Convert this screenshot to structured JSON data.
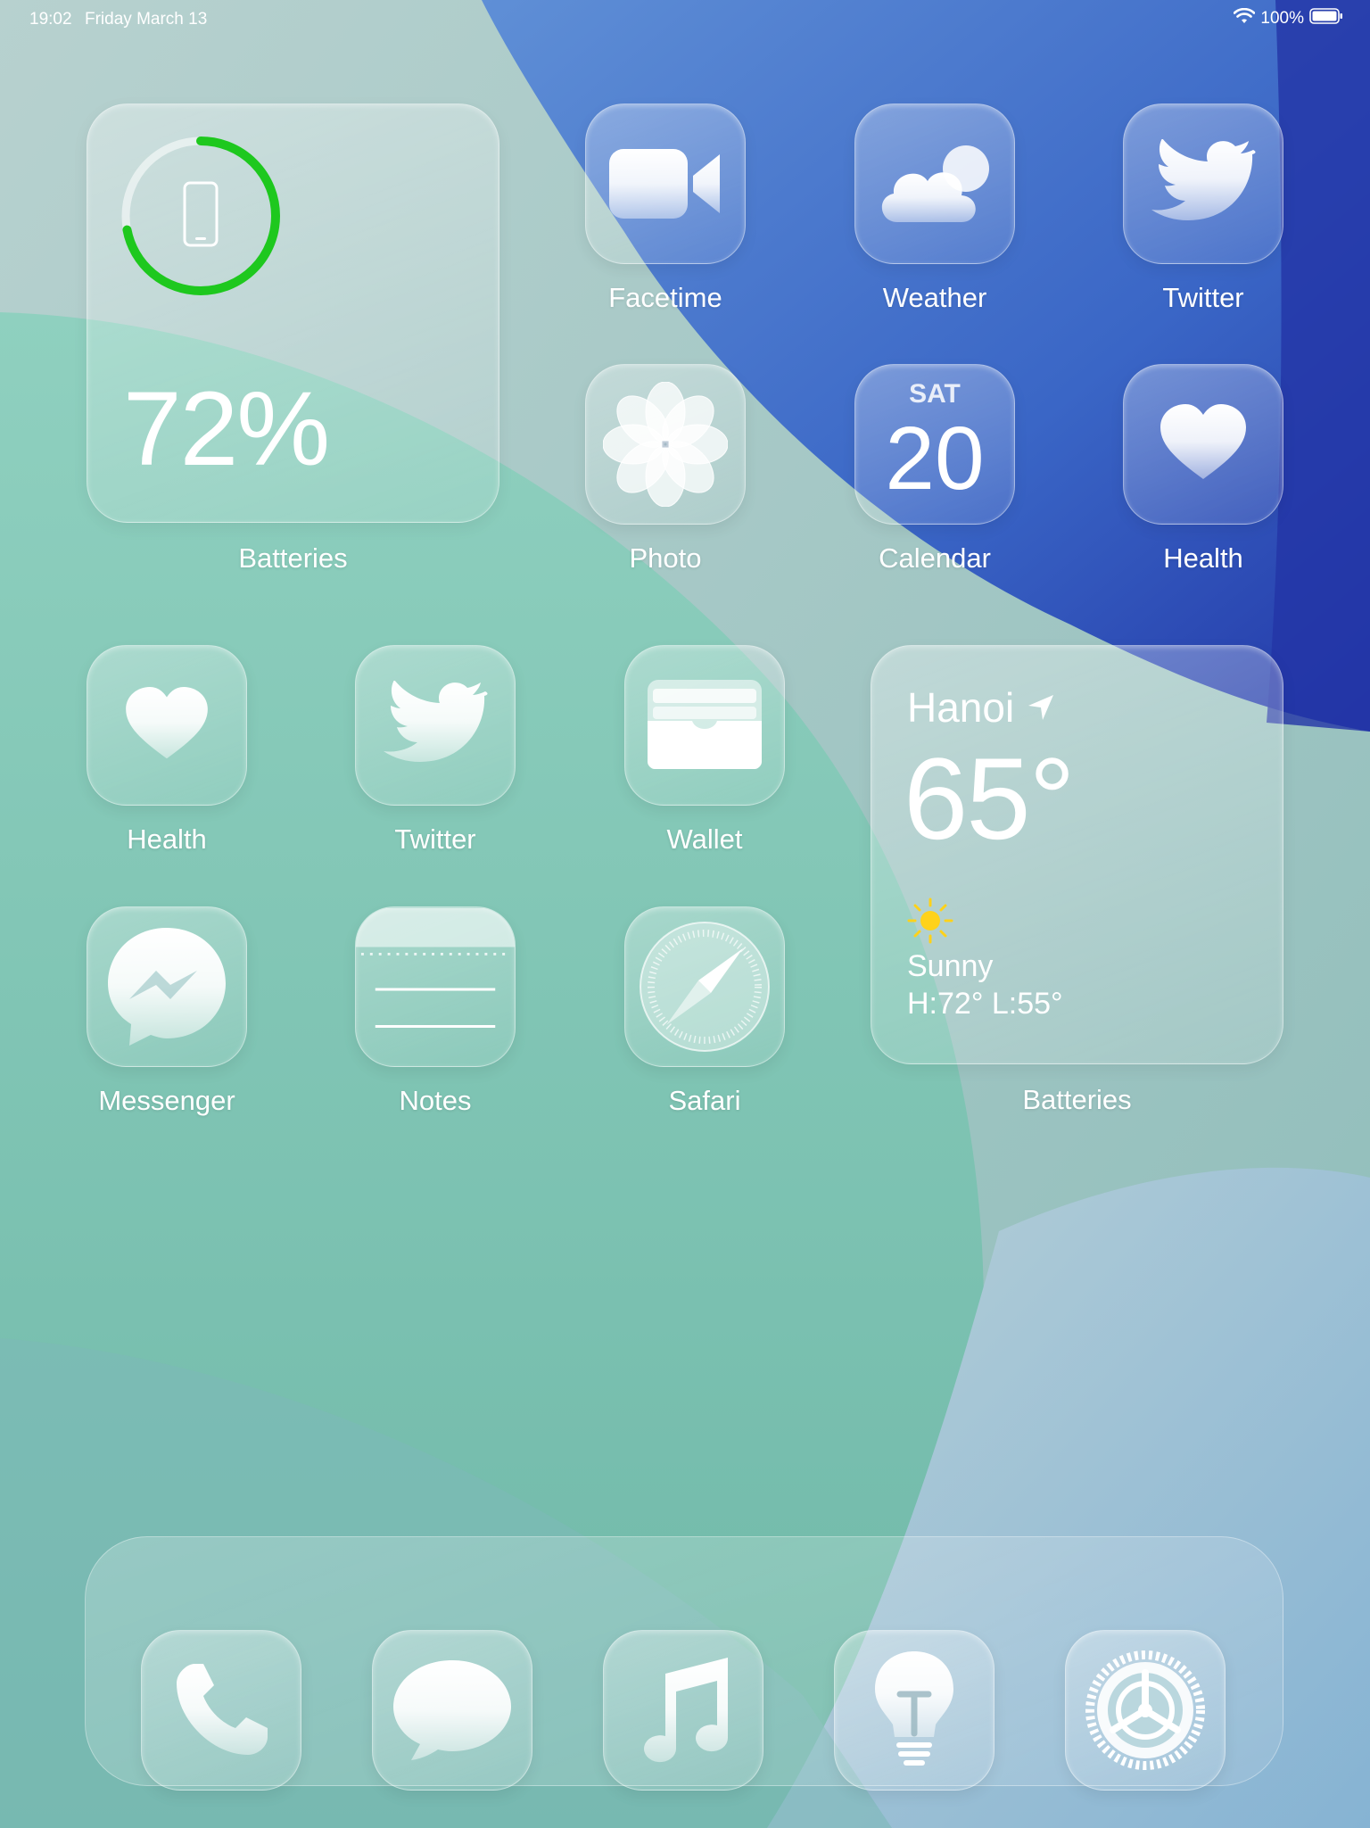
{
  "status_bar": {
    "time": "19:02",
    "date": "Friday March 13",
    "battery_percent": "100%"
  },
  "battery_widget": {
    "percent_text": "72%",
    "level": 0.72,
    "label": "Batteries",
    "ring_color": "#1ec81e"
  },
  "weather_widget": {
    "city": "Hanoi",
    "temperature": "65°",
    "condition": "Sunny",
    "high_low": "H:72° L:55°",
    "label": "Batteries",
    "sun_color": "#ffd21a"
  },
  "calendar_icon": {
    "weekday": "SAT",
    "day": "20"
  },
  "apps": {
    "facetime": "Facetime",
    "weather": "Weather",
    "twitter_top": "Twitter",
    "photo": "Photo",
    "calendar": "Calendar",
    "health_top": "Health",
    "health": "Health",
    "twitter": "Twitter",
    "wallet": "Wallet",
    "messenger": "Messenger",
    "notes": "Notes",
    "safari": "Safari"
  },
  "dock": {
    "items": [
      "phone-icon",
      "messages-icon",
      "music-icon",
      "tips-icon",
      "settings-icon"
    ]
  }
}
